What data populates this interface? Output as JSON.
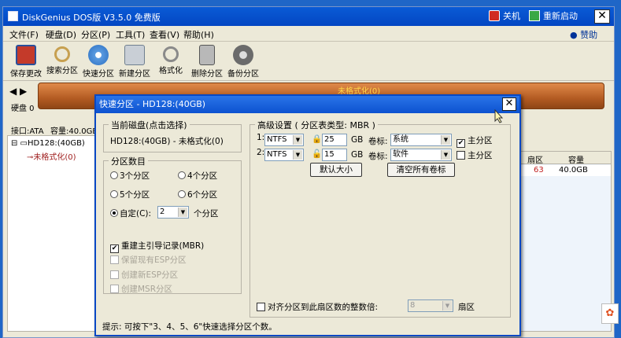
{
  "window": {
    "title": "DiskGenius DOS版 V3.5.0 免费版",
    "shutdown_label": "关机",
    "reboot_label": "重新启动",
    "close_glyph": "✕"
  },
  "menu": {
    "items": [
      "文件(F)",
      "硬盘(D)",
      "分区(P)",
      "工具(T)",
      "查看(V)",
      "帮助(H)"
    ],
    "donate_label": "赞助"
  },
  "toolbar": {
    "items": [
      {
        "label": "保存更改",
        "icon": "save-disk-icon",
        "color": "#c43a2a"
      },
      {
        "label": "搜索分区",
        "icon": "magnifier-icon",
        "color": "#c7a050"
      },
      {
        "label": "快速分区",
        "icon": "quick-partition-disc-icon",
        "color": "#2b6fc2"
      },
      {
        "label": "新建分区",
        "icon": "new-partition-icon",
        "color": "#6f7f8f"
      },
      {
        "label": "格式化",
        "icon": "format-icon",
        "color": "#8a8a8a"
      },
      {
        "label": "删除分区",
        "icon": "trash-icon",
        "color": "#7a7a7a"
      },
      {
        "label": "备份分区",
        "icon": "backup-icon",
        "color": "#6b6b6b"
      }
    ]
  },
  "disk_area": {
    "disk_label": "硬盘 0",
    "bar_label": "未格式化(0)",
    "interface": "接口:ATA",
    "capacity": "容量:40.0GB"
  },
  "tree": {
    "disk": "HD128:(40GB)",
    "partition": "未格式化(0)"
  },
  "grid": {
    "headers": [
      "扇区",
      "容量"
    ],
    "row": {
      "sector": "63",
      "capacity": "40.0GB"
    }
  },
  "dialog": {
    "title": "快速分区 - HD128:(40GB)",
    "current_disk_label": "当前磁盘(点击选择)",
    "current_disk_value": "HD128:(40GB) - 未格式化(0)",
    "partition_count_label": "分区数目",
    "options": [
      "3个分区",
      "4个分区",
      "5个分区",
      "6个分区"
    ],
    "custom_label": "自定(C):",
    "custom_value": "2",
    "custom_suffix": "个分区",
    "rebuild_mbr": "重建主引导记录(MBR)",
    "keep_esp": "保留现有ESP分区",
    "create_esp": "创建新ESP分区",
    "create_msr": "创建MSR分区",
    "advanced_label": "高级设置 ( 分区表类型: MBR )",
    "rows": [
      {
        "index": "1:",
        "fs": "NTFS",
        "size": "25",
        "unit": "GB",
        "vol_label": "卷标:",
        "vol": "系统",
        "primary": "主分区",
        "checked": true
      },
      {
        "index": "2:",
        "fs": "NTFS",
        "size": "15",
        "unit": "GB",
        "vol_label": "卷标:",
        "vol": "软件",
        "primary": "主分区",
        "checked": false
      }
    ],
    "default_size_btn": "默认大小",
    "clear_labels_btn": "清空所有卷标",
    "align_label": "对齐分区到此扇区数的整数倍:",
    "align_value": "8",
    "align_unit": "扇区",
    "hint": "提示: 可按下\"3、4、5、6\"快速选择分区个数。"
  }
}
